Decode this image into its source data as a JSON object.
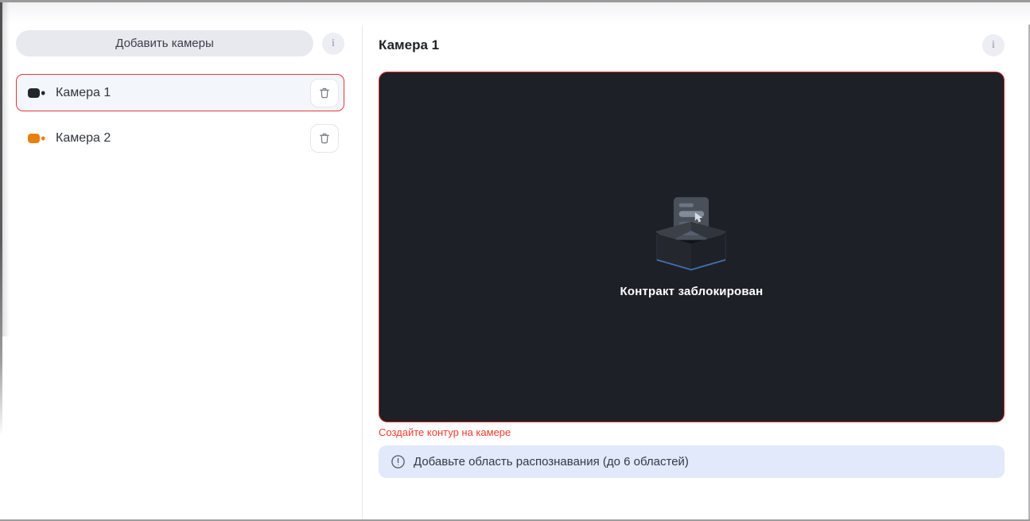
{
  "sidebar": {
    "add_button_label": "Добавить камеры",
    "info_button_label": "i",
    "cameras": [
      {
        "name": "Камера 1",
        "selected": true,
        "icon": "video-camera-icon",
        "icon_color": "#23262b"
      },
      {
        "name": "Камера 2",
        "selected": false,
        "icon": "video-camera-icon",
        "icon_color": "#e8800f"
      }
    ],
    "delete_icon": "trash-icon"
  },
  "main": {
    "title": "Камера 1",
    "info_button_label": "i",
    "preview": {
      "status_text": "Контракт заблокирован",
      "illustration": "empty-open-box-icon"
    },
    "error_text": "Создайте контур на камере",
    "banner": {
      "text": "Добавьте область распознавания (до 6 областей)",
      "icon": "alert-circle-icon"
    }
  },
  "colors": {
    "accent_red": "#e02b2b",
    "error_text": "#f43b2e",
    "selected_item_bg": "#f3f6fb",
    "banner_bg": "#e1e9fb",
    "preview_bg": "#1d2026",
    "button_bg": "#e8e9ef",
    "camera1_icon": "#23262b",
    "camera2_icon": "#e8800f"
  }
}
